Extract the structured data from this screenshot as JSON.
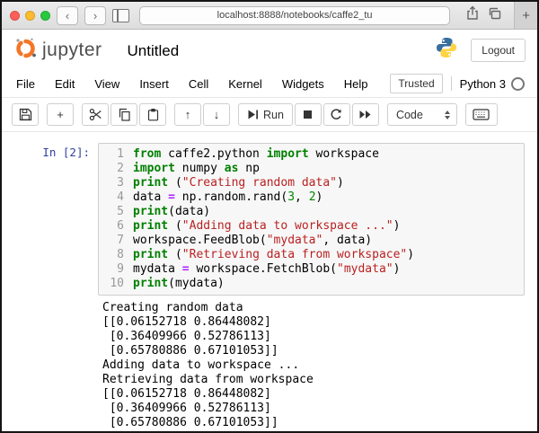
{
  "browser": {
    "url": "localhost:8888/notebooks/caffe2_tu",
    "traffic_lights": {
      "close": "#ff5f57",
      "minimize": "#fdbc2e",
      "zoom": "#28c83f"
    },
    "new_tab_label": "+"
  },
  "header": {
    "logo_text": "jupyter",
    "title": "Untitled",
    "logout_label": "Logout",
    "brand_color": "#f37626"
  },
  "menu": {
    "items": [
      "File",
      "Edit",
      "View",
      "Insert",
      "Cell",
      "Kernel",
      "Widgets",
      "Help"
    ],
    "trusted_label": "Trusted",
    "kernel_label": "Python 3"
  },
  "toolbar": {
    "run_label": "Run",
    "cell_type": "Code"
  },
  "cell": {
    "prompt": "In [2]:",
    "lines": [
      [
        {
          "t": "kw",
          "v": "from"
        },
        {
          "t": "plain",
          "v": " caffe2.python "
        },
        {
          "t": "kw",
          "v": "import"
        },
        {
          "t": "plain",
          "v": " workspace"
        }
      ],
      [
        {
          "t": "kw",
          "v": "import"
        },
        {
          "t": "plain",
          "v": " numpy "
        },
        {
          "t": "kw",
          "v": "as"
        },
        {
          "t": "plain",
          "v": " np"
        }
      ],
      [
        {
          "t": "kw",
          "v": "print"
        },
        {
          "t": "plain",
          "v": " ("
        },
        {
          "t": "str",
          "v": "\"Creating random data\""
        },
        {
          "t": "plain",
          "v": ")"
        }
      ],
      [
        {
          "t": "plain",
          "v": "data "
        },
        {
          "t": "op",
          "v": "="
        },
        {
          "t": "plain",
          "v": " np.random.rand("
        },
        {
          "t": "num",
          "v": "3"
        },
        {
          "t": "plain",
          "v": ", "
        },
        {
          "t": "num",
          "v": "2"
        },
        {
          "t": "plain",
          "v": ")"
        }
      ],
      [
        {
          "t": "kw",
          "v": "print"
        },
        {
          "t": "plain",
          "v": "(data)"
        }
      ],
      [
        {
          "t": "kw",
          "v": "print"
        },
        {
          "t": "plain",
          "v": " ("
        },
        {
          "t": "str",
          "v": "\"Adding data to workspace ...\""
        },
        {
          "t": "plain",
          "v": ")"
        }
      ],
      [
        {
          "t": "plain",
          "v": "workspace.FeedBlob("
        },
        {
          "t": "str",
          "v": "\"mydata\""
        },
        {
          "t": "plain",
          "v": ", data)"
        }
      ],
      [
        {
          "t": "kw",
          "v": "print"
        },
        {
          "t": "plain",
          "v": " ("
        },
        {
          "t": "str",
          "v": "\"Retrieving data from workspace\""
        },
        {
          "t": "plain",
          "v": ")"
        }
      ],
      [
        {
          "t": "plain",
          "v": "mydata "
        },
        {
          "t": "op",
          "v": "="
        },
        {
          "t": "plain",
          "v": " workspace.FetchBlob("
        },
        {
          "t": "str",
          "v": "\"mydata\""
        },
        {
          "t": "plain",
          "v": ")"
        }
      ],
      [
        {
          "t": "kw",
          "v": "print"
        },
        {
          "t": "plain",
          "v": "(mydata)"
        }
      ]
    ],
    "output_lines": [
      "Creating random data",
      "[[0.06152718 0.86448082]",
      " [0.36409966 0.52786113]",
      " [0.65780886 0.67101053]]",
      "Adding data to workspace ...",
      "Retrieving data from workspace",
      "[[0.06152718 0.86448082]",
      " [0.36409966 0.52786113]",
      " [0.65780886 0.67101053]]"
    ]
  }
}
